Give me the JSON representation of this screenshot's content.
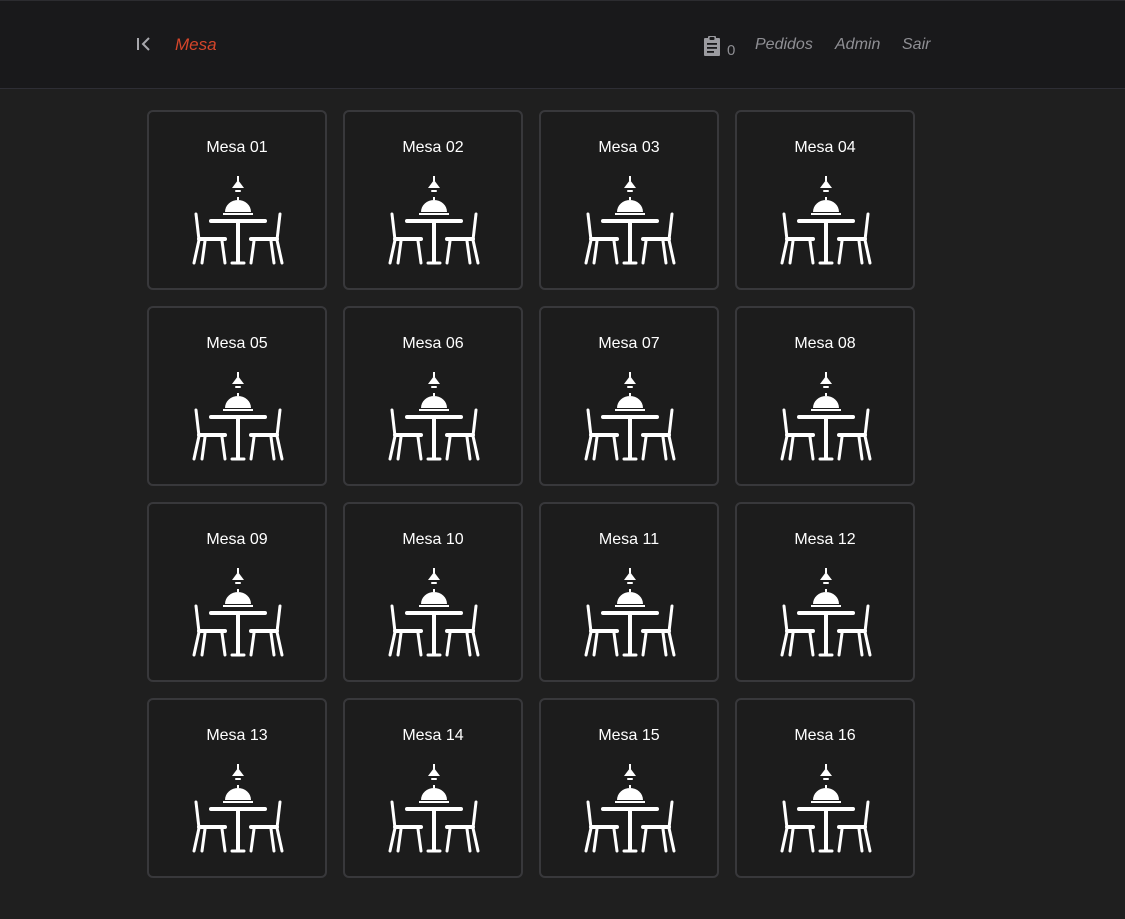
{
  "navbar": {
    "back_icon": "collapse-left-icon",
    "brand": "Mesa",
    "orders_icon": "clipboard-icon",
    "orders_count": "0",
    "links": {
      "pedidos": "Pedidos",
      "admin": "Admin",
      "sair": "Sair"
    },
    "brand_color": "#d4452a"
  },
  "tables": [
    {
      "label": "Mesa 01",
      "icon": "dining-table-icon"
    },
    {
      "label": "Mesa 02",
      "icon": "dining-table-icon"
    },
    {
      "label": "Mesa 03",
      "icon": "dining-table-icon"
    },
    {
      "label": "Mesa 04",
      "icon": "dining-table-icon"
    },
    {
      "label": "Mesa 05",
      "icon": "dining-table-icon"
    },
    {
      "label": "Mesa 06",
      "icon": "dining-table-icon"
    },
    {
      "label": "Mesa 07",
      "icon": "dining-table-icon"
    },
    {
      "label": "Mesa 08",
      "icon": "dining-table-icon"
    },
    {
      "label": "Mesa 09",
      "icon": "dining-table-icon"
    },
    {
      "label": "Mesa 10",
      "icon": "dining-table-icon"
    },
    {
      "label": "Mesa 11",
      "icon": "dining-table-icon"
    },
    {
      "label": "Mesa 12",
      "icon": "dining-table-icon"
    },
    {
      "label": "Mesa 13",
      "icon": "dining-table-icon"
    },
    {
      "label": "Mesa 14",
      "icon": "dining-table-icon"
    },
    {
      "label": "Mesa 15",
      "icon": "dining-table-icon"
    },
    {
      "label": "Mesa 16",
      "icon": "dining-table-icon"
    }
  ]
}
